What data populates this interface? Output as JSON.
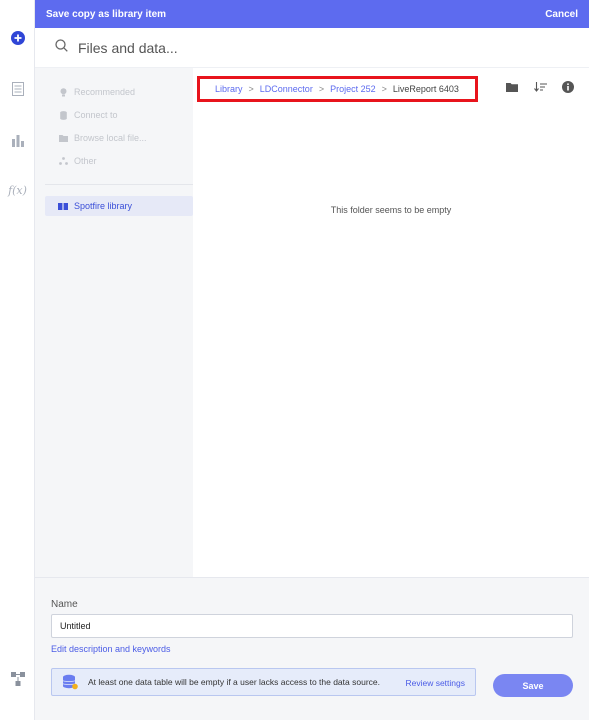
{
  "dialog": {
    "title": "Save copy as library item",
    "cancel_label": "Cancel"
  },
  "search": {
    "placeholder": "Files and data..."
  },
  "sidebar": {
    "items": [
      {
        "label": "Recommended",
        "icon": "lightbulb-icon"
      },
      {
        "label": "Connect to",
        "icon": "database-icon"
      },
      {
        "label": "Browse local file...",
        "icon": "folder-icon"
      },
      {
        "label": "Other",
        "icon": "dots-icon"
      }
    ],
    "library": {
      "label": "Spotfire library",
      "icon": "book-icon"
    }
  },
  "breadcrumb": {
    "items": [
      "Library",
      "LDConnector",
      "Project 252"
    ],
    "current": "LiveReport 6403",
    "separator": ">"
  },
  "content": {
    "empty_message": "This folder seems to be empty"
  },
  "footer": {
    "name_label": "Name",
    "name_value": "Untitled",
    "edit_link": "Edit description and keywords",
    "warning_text": "At least one data table will be empty if a user lacks access to the data source.",
    "review_label": "Review settings",
    "save_label": "Save"
  },
  "colors": {
    "accent": "#5d6bef",
    "highlight_border": "#e8141c",
    "panel_bg": "#f5f6f8"
  }
}
